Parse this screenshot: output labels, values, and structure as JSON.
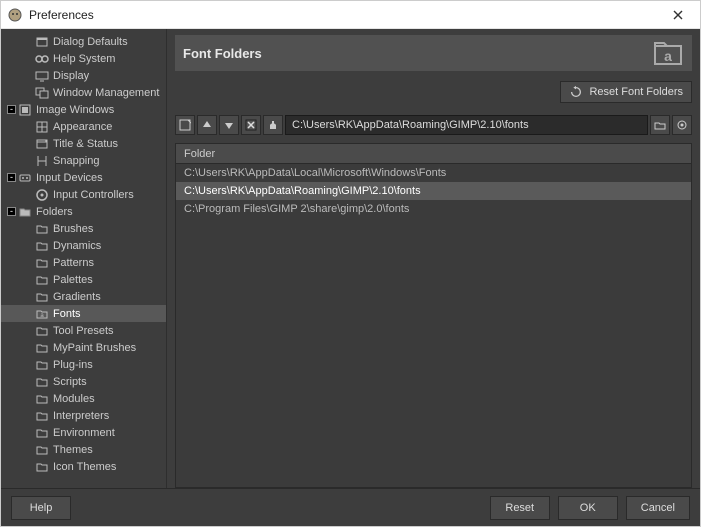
{
  "window": {
    "title": "Preferences"
  },
  "sidebar": {
    "items": [
      {
        "label": "Dialog Defaults",
        "depth": 2,
        "icon": "dialog"
      },
      {
        "label": "Help System",
        "depth": 2,
        "icon": "help"
      },
      {
        "label": "Display",
        "depth": 2,
        "icon": "display"
      },
      {
        "label": "Window Management",
        "depth": 2,
        "icon": "window"
      },
      {
        "label": "Image Windows",
        "depth": 1,
        "icon": "image-windows",
        "expander": "-"
      },
      {
        "label": "Appearance",
        "depth": 2,
        "icon": "appearance"
      },
      {
        "label": "Title & Status",
        "depth": 2,
        "icon": "title-status"
      },
      {
        "label": "Snapping",
        "depth": 2,
        "icon": "snapping"
      },
      {
        "label": "Input Devices",
        "depth": 1,
        "icon": "input-devices",
        "expander": "-"
      },
      {
        "label": "Input Controllers",
        "depth": 2,
        "icon": "controllers"
      },
      {
        "label": "Folders",
        "depth": 1,
        "icon": "folders",
        "expander": "-"
      },
      {
        "label": "Brushes",
        "depth": 2,
        "icon": "folder"
      },
      {
        "label": "Dynamics",
        "depth": 2,
        "icon": "folder"
      },
      {
        "label": "Patterns",
        "depth": 2,
        "icon": "folder"
      },
      {
        "label": "Palettes",
        "depth": 2,
        "icon": "folder"
      },
      {
        "label": "Gradients",
        "depth": 2,
        "icon": "folder"
      },
      {
        "label": "Fonts",
        "depth": 2,
        "icon": "folder-font",
        "selected": true
      },
      {
        "label": "Tool Presets",
        "depth": 2,
        "icon": "folder"
      },
      {
        "label": "MyPaint Brushes",
        "depth": 2,
        "icon": "folder"
      },
      {
        "label": "Plug-ins",
        "depth": 2,
        "icon": "folder"
      },
      {
        "label": "Scripts",
        "depth": 2,
        "icon": "folder"
      },
      {
        "label": "Modules",
        "depth": 2,
        "icon": "folder"
      },
      {
        "label": "Interpreters",
        "depth": 2,
        "icon": "folder"
      },
      {
        "label": "Environment",
        "depth": 2,
        "icon": "folder"
      },
      {
        "label": "Themes",
        "depth": 2,
        "icon": "folder"
      },
      {
        "label": "Icon Themes",
        "depth": 2,
        "icon": "folder"
      }
    ]
  },
  "header": {
    "title": "Font Folders"
  },
  "reset_button": "Reset Font Folders",
  "path_input": {
    "value": "C:\\Users\\RK\\AppData\\Roaming\\GIMP\\2.10\\fonts"
  },
  "column_header": "Folder",
  "rows": [
    {
      "path": "C:\\Users\\RK\\AppData\\Local\\Microsoft\\Windows\\Fonts"
    },
    {
      "path": "C:\\Users\\RK\\AppData\\Roaming\\GIMP\\2.10\\fonts",
      "selected": true
    },
    {
      "path": "C:\\Program Files\\GIMP 2\\share\\gimp\\2.0\\fonts"
    }
  ],
  "footer": {
    "help": "Help",
    "reset": "Reset",
    "ok": "OK",
    "cancel": "Cancel"
  }
}
